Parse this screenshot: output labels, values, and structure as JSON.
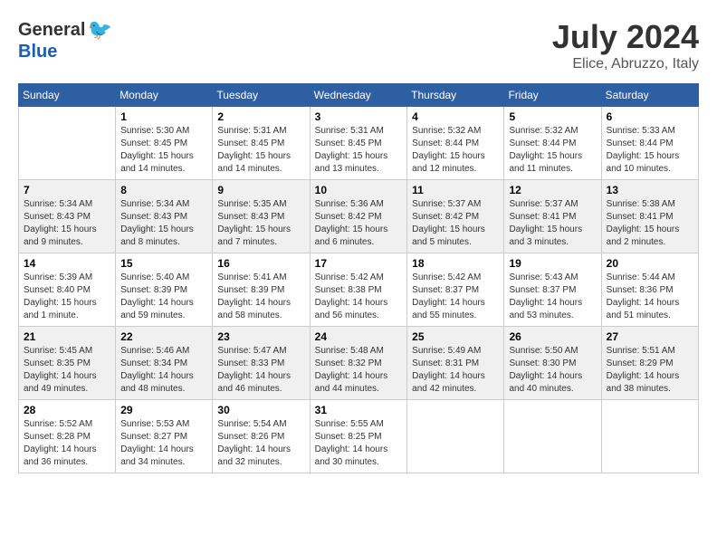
{
  "logo": {
    "general": "General",
    "blue": "Blue"
  },
  "header": {
    "month": "July 2024",
    "location": "Elice, Abruzzo, Italy"
  },
  "weekdays": [
    "Sunday",
    "Monday",
    "Tuesday",
    "Wednesday",
    "Thursday",
    "Friday",
    "Saturday"
  ],
  "weeks": [
    [
      {
        "day": null
      },
      {
        "day": "1",
        "sunrise": "5:30 AM",
        "sunset": "8:45 PM",
        "daylight": "15 hours and 14 minutes."
      },
      {
        "day": "2",
        "sunrise": "5:31 AM",
        "sunset": "8:45 PM",
        "daylight": "15 hours and 14 minutes."
      },
      {
        "day": "3",
        "sunrise": "5:31 AM",
        "sunset": "8:45 PM",
        "daylight": "15 hours and 13 minutes."
      },
      {
        "day": "4",
        "sunrise": "5:32 AM",
        "sunset": "8:44 PM",
        "daylight": "15 hours and 12 minutes."
      },
      {
        "day": "5",
        "sunrise": "5:32 AM",
        "sunset": "8:44 PM",
        "daylight": "15 hours and 11 minutes."
      },
      {
        "day": "6",
        "sunrise": "5:33 AM",
        "sunset": "8:44 PM",
        "daylight": "15 hours and 10 minutes."
      }
    ],
    [
      {
        "day": "7",
        "sunrise": "5:34 AM",
        "sunset": "8:43 PM",
        "daylight": "15 hours and 9 minutes."
      },
      {
        "day": "8",
        "sunrise": "5:34 AM",
        "sunset": "8:43 PM",
        "daylight": "15 hours and 8 minutes."
      },
      {
        "day": "9",
        "sunrise": "5:35 AM",
        "sunset": "8:43 PM",
        "daylight": "15 hours and 7 minutes."
      },
      {
        "day": "10",
        "sunrise": "5:36 AM",
        "sunset": "8:42 PM",
        "daylight": "15 hours and 6 minutes."
      },
      {
        "day": "11",
        "sunrise": "5:37 AM",
        "sunset": "8:42 PM",
        "daylight": "15 hours and 5 minutes."
      },
      {
        "day": "12",
        "sunrise": "5:37 AM",
        "sunset": "8:41 PM",
        "daylight": "15 hours and 3 minutes."
      },
      {
        "day": "13",
        "sunrise": "5:38 AM",
        "sunset": "8:41 PM",
        "daylight": "15 hours and 2 minutes."
      }
    ],
    [
      {
        "day": "14",
        "sunrise": "5:39 AM",
        "sunset": "8:40 PM",
        "daylight": "15 hours and 1 minute."
      },
      {
        "day": "15",
        "sunrise": "5:40 AM",
        "sunset": "8:39 PM",
        "daylight": "14 hours and 59 minutes."
      },
      {
        "day": "16",
        "sunrise": "5:41 AM",
        "sunset": "8:39 PM",
        "daylight": "14 hours and 58 minutes."
      },
      {
        "day": "17",
        "sunrise": "5:42 AM",
        "sunset": "8:38 PM",
        "daylight": "14 hours and 56 minutes."
      },
      {
        "day": "18",
        "sunrise": "5:42 AM",
        "sunset": "8:37 PM",
        "daylight": "14 hours and 55 minutes."
      },
      {
        "day": "19",
        "sunrise": "5:43 AM",
        "sunset": "8:37 PM",
        "daylight": "14 hours and 53 minutes."
      },
      {
        "day": "20",
        "sunrise": "5:44 AM",
        "sunset": "8:36 PM",
        "daylight": "14 hours and 51 minutes."
      }
    ],
    [
      {
        "day": "21",
        "sunrise": "5:45 AM",
        "sunset": "8:35 PM",
        "daylight": "14 hours and 49 minutes."
      },
      {
        "day": "22",
        "sunrise": "5:46 AM",
        "sunset": "8:34 PM",
        "daylight": "14 hours and 48 minutes."
      },
      {
        "day": "23",
        "sunrise": "5:47 AM",
        "sunset": "8:33 PM",
        "daylight": "14 hours and 46 minutes."
      },
      {
        "day": "24",
        "sunrise": "5:48 AM",
        "sunset": "8:32 PM",
        "daylight": "14 hours and 44 minutes."
      },
      {
        "day": "25",
        "sunrise": "5:49 AM",
        "sunset": "8:31 PM",
        "daylight": "14 hours and 42 minutes."
      },
      {
        "day": "26",
        "sunrise": "5:50 AM",
        "sunset": "8:30 PM",
        "daylight": "14 hours and 40 minutes."
      },
      {
        "day": "27",
        "sunrise": "5:51 AM",
        "sunset": "8:29 PM",
        "daylight": "14 hours and 38 minutes."
      }
    ],
    [
      {
        "day": "28",
        "sunrise": "5:52 AM",
        "sunset": "8:28 PM",
        "daylight": "14 hours and 36 minutes."
      },
      {
        "day": "29",
        "sunrise": "5:53 AM",
        "sunset": "8:27 PM",
        "daylight": "14 hours and 34 minutes."
      },
      {
        "day": "30",
        "sunrise": "5:54 AM",
        "sunset": "8:26 PM",
        "daylight": "14 hours and 32 minutes."
      },
      {
        "day": "31",
        "sunrise": "5:55 AM",
        "sunset": "8:25 PM",
        "daylight": "14 hours and 30 minutes."
      },
      {
        "day": null
      },
      {
        "day": null
      },
      {
        "day": null
      }
    ]
  ]
}
